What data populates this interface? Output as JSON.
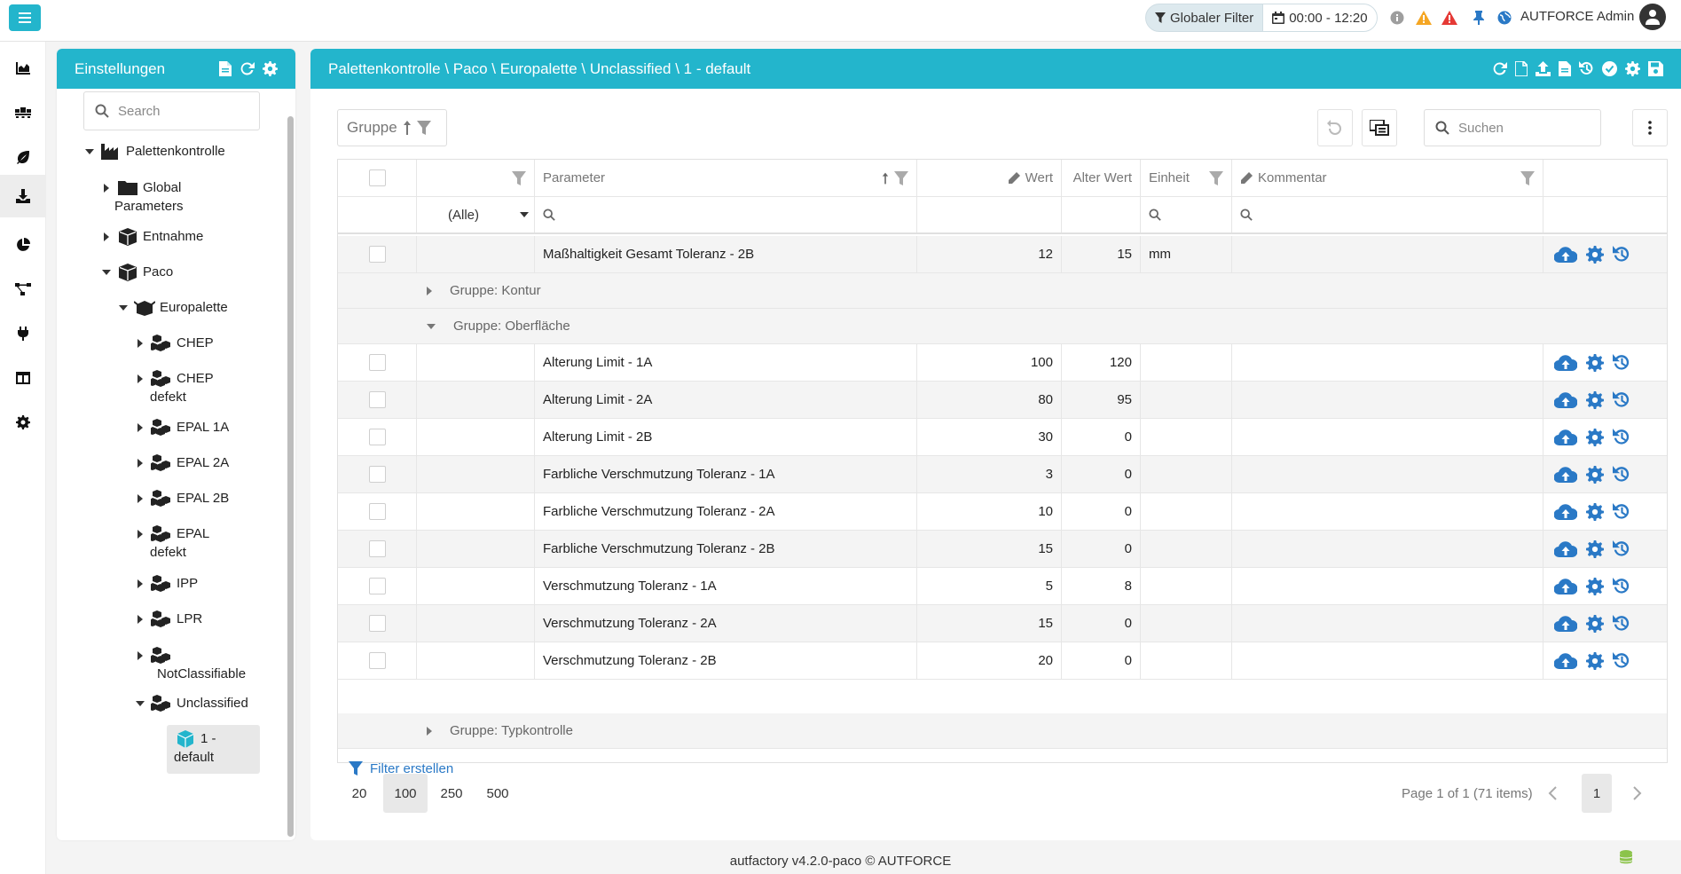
{
  "topbar": {
    "global_filter_label": "Globaler Filter",
    "time_range": "00:00 - 12:20",
    "user_name": "AUTFORCE Admin",
    "colors": {
      "accent": "#23b5cc",
      "warning": "#f5a623",
      "error": "#e53935",
      "link": "#2a79c6",
      "db": "#8bc34a"
    }
  },
  "rail": {
    "items": [
      "chart-icon",
      "pallets-icon",
      "leaf-icon",
      "download-icon",
      "pie-chart-icon",
      "workflow-icon",
      "plug-icon",
      "table-icon",
      "gear-icon"
    ],
    "active_index": 3
  },
  "settings": {
    "title": "Einstellungen",
    "search_placeholder": "Search",
    "tree": {
      "palettenkontrolle": "Palettenkontrolle",
      "global": "Global",
      "parameters": "Parameters",
      "entnahme": "Entnahme",
      "paco": "Paco",
      "europalette": "Europalette",
      "chep": "CHEP",
      "chep_defekt_1": "CHEP",
      "chep_defekt_2": "defekt",
      "epal1a": "EPAL 1A",
      "epal2a": "EPAL 2A",
      "epal2b": "EPAL 2B",
      "epal_defekt_1": "EPAL",
      "epal_defekt_2": "defekt",
      "ipp": "IPP",
      "lpr": "LPR",
      "notclassifiable": "NotClassifiable",
      "unclassified": "Unclassified",
      "default_1": "1 -",
      "default_2": "default"
    }
  },
  "main": {
    "breadcrumb": "Palettenkontrolle \\ Paco \\ Europalette \\ Unclassified \\ 1 - default",
    "group_panel_label": "Gruppe",
    "search_placeholder": "Suchen",
    "columns": {
      "parameter": "Parameter",
      "wert": "Wert",
      "alter_wert": "Alter Wert",
      "einheit": "Einheit",
      "kommentar": "Kommentar"
    },
    "filter_select_value": "(Alle)",
    "top_row": {
      "parameter": "Maßhaltigkeit Gesamt Toleranz - 2B",
      "wert": "12",
      "alter_wert": "15",
      "einheit": "mm"
    },
    "groups": {
      "kontur": "Gruppe: Kontur",
      "oberflaeche": "Gruppe: Oberfläche",
      "typkontrolle": "Gruppe: Typkontrolle"
    },
    "rows": [
      {
        "parameter": "Alterung Limit - 1A",
        "wert": "100",
        "alter_wert": "120"
      },
      {
        "parameter": "Alterung Limit - 2A",
        "wert": "80",
        "alter_wert": "95"
      },
      {
        "parameter": "Alterung Limit - 2B",
        "wert": "30",
        "alter_wert": "0"
      },
      {
        "parameter": "Farbliche Verschmutzung Toleranz - 1A",
        "wert": "3",
        "alter_wert": "0"
      },
      {
        "parameter": "Farbliche Verschmutzung Toleranz - 2A",
        "wert": "10",
        "alter_wert": "0"
      },
      {
        "parameter": "Farbliche Verschmutzung Toleranz - 2B",
        "wert": "15",
        "alter_wert": "0"
      },
      {
        "parameter": "Verschmutzung Toleranz - 1A",
        "wert": "5",
        "alter_wert": "8"
      },
      {
        "parameter": "Verschmutzung Toleranz - 2A",
        "wert": "15",
        "alter_wert": "0"
      },
      {
        "parameter": "Verschmutzung Toleranz - 2B",
        "wert": "20",
        "alter_wert": "0"
      }
    ],
    "filter_create_label": "Filter erstellen",
    "page_sizes": [
      "20",
      "100",
      "250",
      "500"
    ],
    "active_page_size": "100",
    "page_info": "Page 1 of 1 (71 items)",
    "current_page": "1"
  },
  "footer": {
    "text": "autfactory v4.2.0-paco © AUTFORCE"
  }
}
